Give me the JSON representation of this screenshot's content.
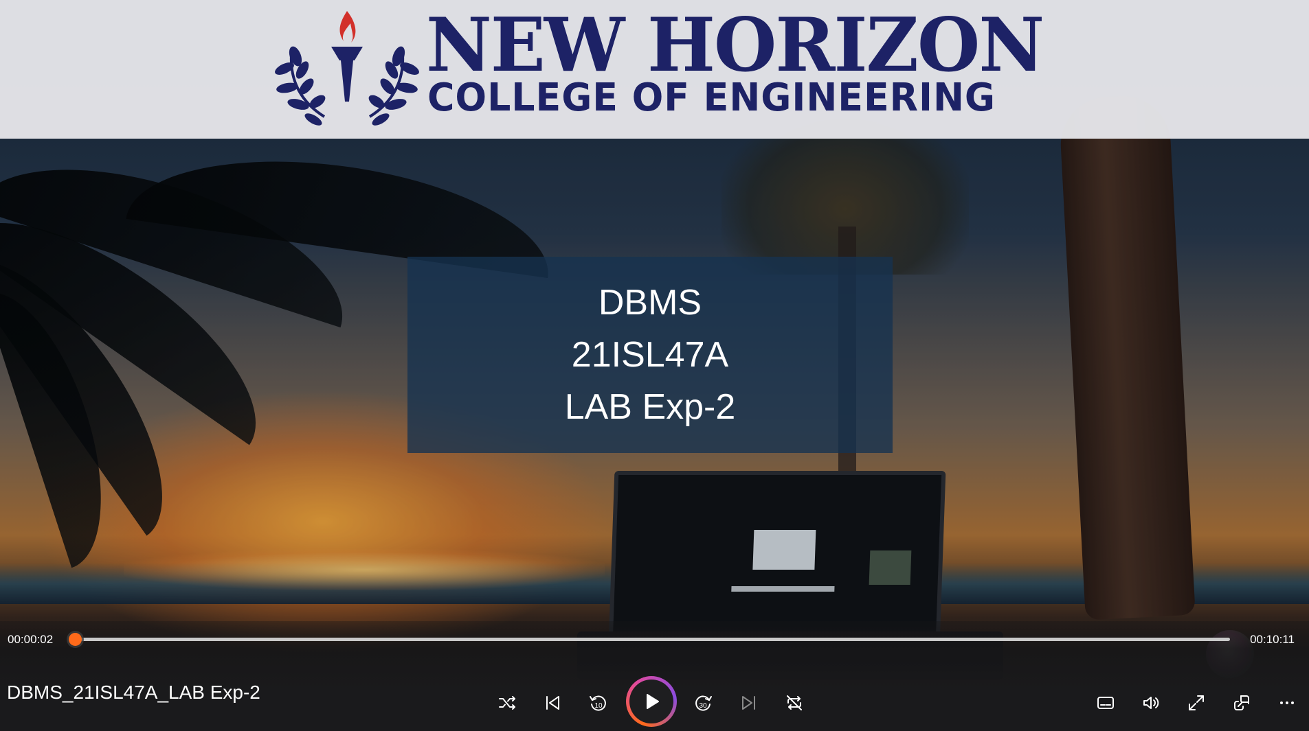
{
  "banner": {
    "brand_name": "NEW HORIZON",
    "brand_sub": "COLLEGE OF ENGINEERING"
  },
  "title_card": {
    "line1": "DBMS",
    "line2": "21ISL47A",
    "line3": "LAB Exp-2"
  },
  "player": {
    "media_title": "DBMS_21ISL47A_LAB Exp-2",
    "elapsed_time": "00:00:02",
    "total_time": "00:10:11",
    "progress_fraction": 0.003,
    "accent_color": "#ff6a1a",
    "controls": {
      "shuffle": "shuffle-icon",
      "previous": "previous-icon",
      "rewind": "rewind-10-icon",
      "rewind_label": "10",
      "play": "play-icon",
      "forward": "forward-30-icon",
      "forward_label": "30",
      "next": "next-icon",
      "repeat": "repeat-off-icon",
      "subtitles": "subtitles-icon",
      "volume": "volume-icon",
      "fullscreen": "fullscreen-icon",
      "miniplayer": "miniplayer-icon",
      "more": "more-icon"
    }
  },
  "colors": {
    "brand_navy": "#1d2266",
    "torch_red": "#d2302a"
  }
}
